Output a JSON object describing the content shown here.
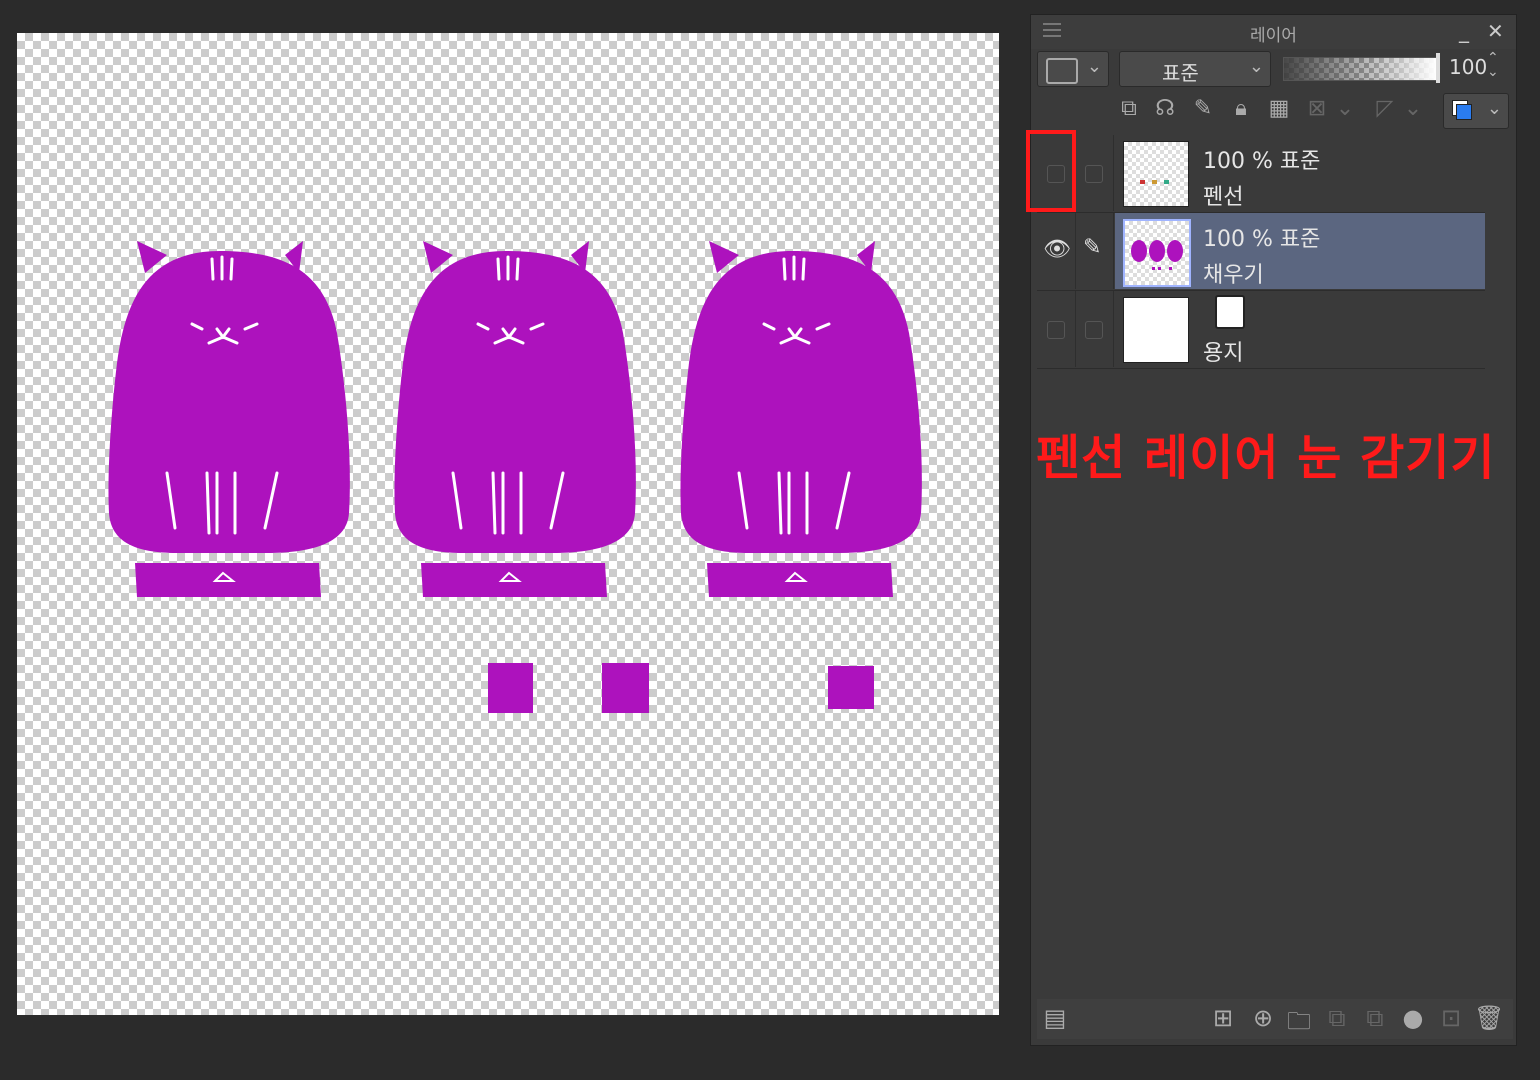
{
  "panel": {
    "title": "레이어",
    "minimize_label": "_",
    "close_label": "✕",
    "blend_mode": "표준",
    "opacity_value": "100",
    "opacity_fraction": 1.0
  },
  "layers": [
    {
      "opacity_mode": "100 % 표준",
      "name": "펜선",
      "visible": false,
      "selected": false
    },
    {
      "opacity_mode": "100 % 표준",
      "name": "채우기",
      "visible": true,
      "selected": true
    },
    {
      "opacity_mode": "",
      "name": "용지",
      "visible": false,
      "selected": false
    }
  ],
  "annotation": {
    "text": "펜선 레이어 눈 감기기"
  },
  "colors": {
    "fill_purple": "#ad12bd",
    "annotation_red": "#ff1a1a",
    "selected_layer": "#5b6680",
    "swatch_fg": "#2a7cf0"
  },
  "icons": {
    "toolbar": [
      "clip-icon",
      "reference-icon",
      "draft-icon",
      "lock-icon",
      "lock-transparency-icon",
      "mask-icon",
      "ruler-icon",
      "color-swatch-icon"
    ],
    "footer": [
      "layer-property-icon",
      "new-raster-layer-icon",
      "new-vector-layer-icon",
      "new-folder-icon",
      "copy-to-lower-icon",
      "merge-lower-icon",
      "mask-add-icon",
      "apply-mask-icon",
      "delete-layer-icon"
    ]
  }
}
